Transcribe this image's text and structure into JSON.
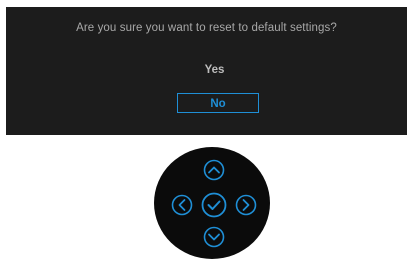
{
  "dialog": {
    "prompt": "Are you sure you want to reset to default settings?",
    "options": [
      {
        "label": "Yes",
        "selected": false
      },
      {
        "label": "No",
        "selected": true
      }
    ]
  },
  "joystick": {
    "buttons": [
      "up-icon",
      "left-icon",
      "confirm-icon",
      "right-icon",
      "down-icon"
    ]
  },
  "colors": {
    "dialog_bg": "#1c1c1c",
    "text": "#a8a8a8",
    "selection": "#1f8fd6",
    "joystick_bg": "#0b0b0b"
  }
}
